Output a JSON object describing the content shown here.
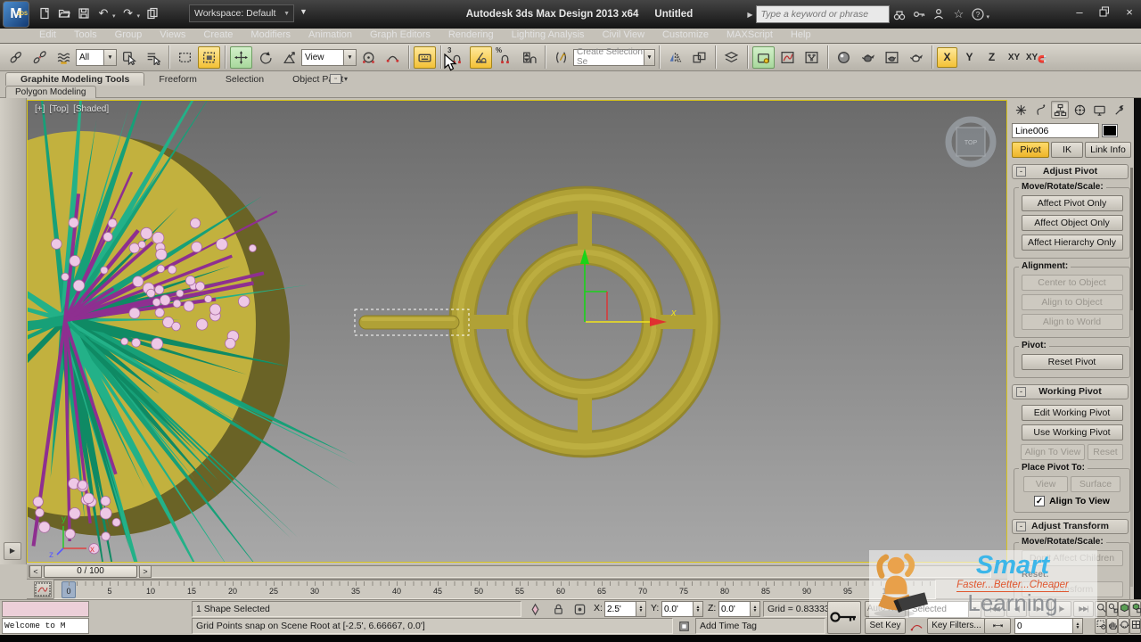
{
  "window": {
    "title": "Autodesk 3ds Max Design 2013 x64",
    "document": "Untitled",
    "workspace": "Workspace: Default",
    "search_placeholder": "Type a keyword or phrase"
  },
  "menubar": [
    "Edit",
    "Tools",
    "Group",
    "Views",
    "Create",
    "Modifiers",
    "Animation",
    "Graph Editors",
    "Rendering",
    "Lighting Analysis",
    "Civil View",
    "Customize",
    "MAXScript",
    "Help"
  ],
  "toolbar": {
    "selection_filter": "All",
    "coord_system": "View",
    "named_sets": "Create Selection Se",
    "snap_count": "3",
    "snap_percent": "%",
    "axis_x": "X",
    "axis_y": "Y",
    "axis_z": "Z",
    "axis_xy": "XY",
    "axis_xy2": "XY"
  },
  "ribbon": {
    "tabs": [
      {
        "label": "Graphite Modeling Tools",
        "active": true
      },
      {
        "label": "Freeform",
        "active": false
      },
      {
        "label": "Selection",
        "active": false
      },
      {
        "label": "Object Paint",
        "active": false
      }
    ],
    "sub_tab": "Polygon Modeling"
  },
  "viewport": {
    "label_plus": "[+]",
    "label_view": "[Top]",
    "label_shading": "[Shaded]",
    "viewcube": "TOP",
    "axis_x": "x",
    "axis_y": "y",
    "axis_z": "z",
    "gizmo_x": "x"
  },
  "command_panel": {
    "object_name": "Line006",
    "tab_pivot": "Pivot",
    "tab_ik": "IK",
    "tab_link": "Link Info",
    "ap_title": "Adjust Pivot",
    "ap_move_group": "Move/Rotate/Scale:",
    "ap_b1": "Affect Pivot Only",
    "ap_b2": "Affect Object Only",
    "ap_b3": "Affect Hierarchy Only",
    "ap_align_group": "Alignment:",
    "ap_c1": "Center to Object",
    "ap_c2": "Align to Object",
    "ap_c3": "Align to World",
    "ap_pivot_group": "Pivot:",
    "ap_reset": "Reset Pivot",
    "wp_title": "Working Pivot",
    "wp_edit": "Edit Working Pivot",
    "wp_use": "Use Working Pivot",
    "wp_align": "Align To View",
    "wp_reset": "Reset",
    "wp_place_group": "Place Pivot To:",
    "wp_view": "View",
    "wp_surface": "Surface",
    "wp_check": "Align To View",
    "at_title": "Adjust Transform",
    "at_move_group": "Move/Rotate/Scale:",
    "at_dont": "Don't Affect Children",
    "at_reset_label": "Reset:",
    "at_transform": "Transform"
  },
  "timeline": {
    "slider": "0 / 100",
    "prev": "<",
    "next": ">",
    "tick_start": 0,
    "tick_end": 100,
    "tick_step": 5
  },
  "statusbar": {
    "listener_text": "Welcome to M",
    "status": "1 Shape Selected",
    "prompt": "Grid Points snap on Scene Root at [-2.5', 6.66667, 0.0']",
    "x_label": "X:",
    "y_label": "Y:",
    "z_label": "Z:",
    "x": "2.5'",
    "y": "0.0'",
    "z": "0.0'",
    "grid": "Grid = 0.83333'",
    "add_time_tag": "Add Time Tag",
    "auto_key": "Auto Key",
    "set_key": "Set Key",
    "selected": "Selected",
    "key_filters": "Key Filters...",
    "frame": "0"
  },
  "watermark": {
    "smart": "Smart",
    "tagline": "Faster...Better...Cheaper",
    "learning": "Learning"
  },
  "colors": {
    "viewport_border": "#d9c51b",
    "highlight_yellow": "#f3c136",
    "highlight_green": "#a8d89c",
    "object_olive": "#b0a136",
    "object_olive_dark": "#897c26",
    "disc_yellow": "#c2b13e",
    "disc_rim": "#6a6326",
    "spike_a": "#17a078",
    "spike_b": "#0f8a64",
    "spike_c": "#23b188",
    "berry_fill": "#eec8e6",
    "berry_edge": "#a86aa0",
    "stem_purple": "#8e2f90",
    "gizmo_green": "#19d419",
    "gizmo_red": "#e03030",
    "gizmo_yellow": "#f2e41a"
  }
}
